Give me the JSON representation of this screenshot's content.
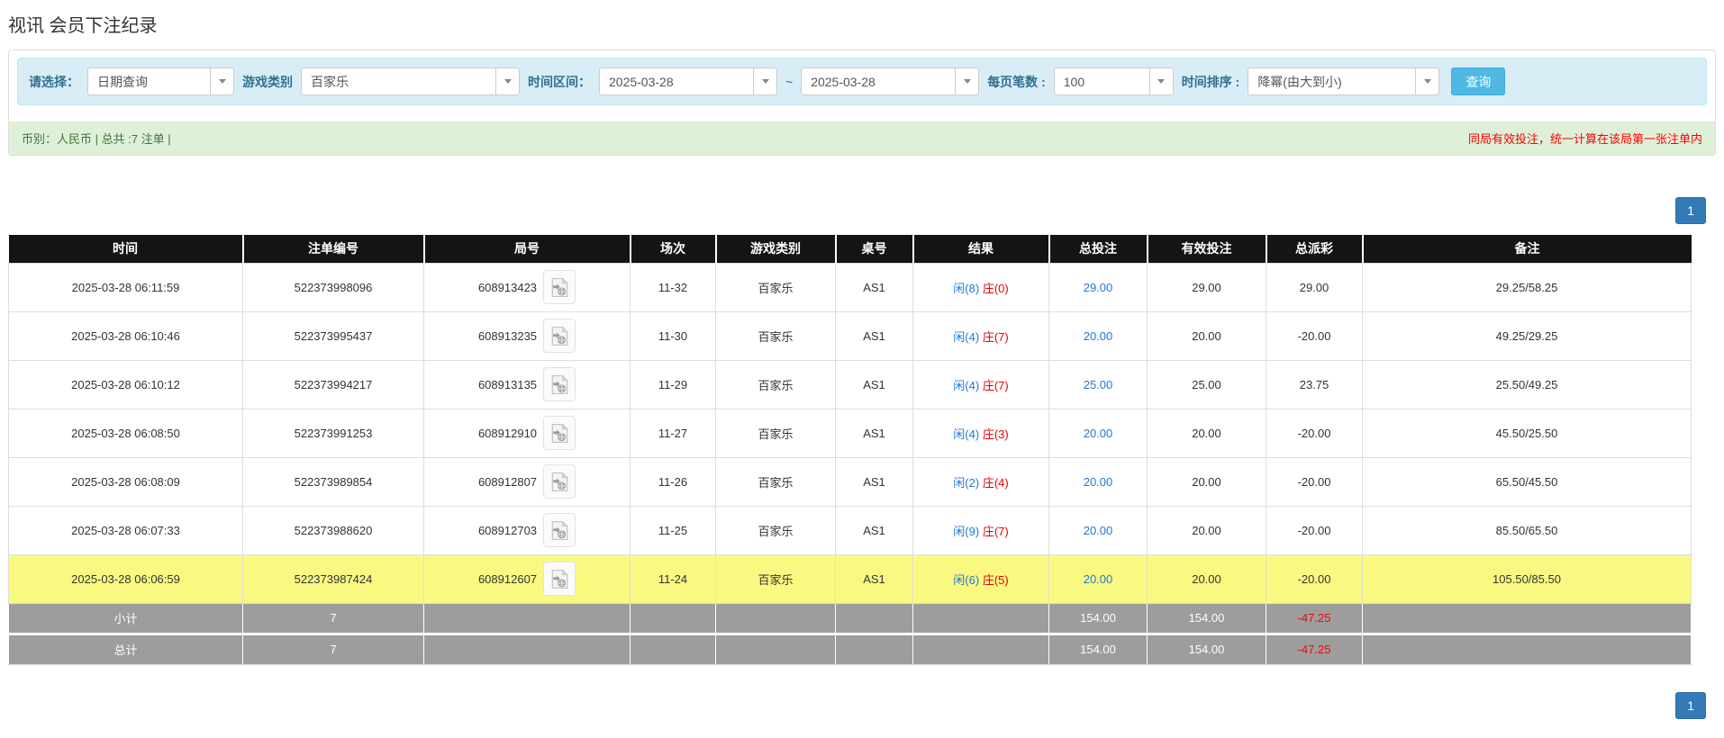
{
  "page": {
    "title": "视讯 会员下注纪录"
  },
  "filters": {
    "select_label": "请选择：",
    "select_value": "日期查询",
    "game_label": "游戏类别",
    "game_value": "百家乐",
    "range_label": "时间区间：",
    "date_from": "2025-03-28",
    "range_separator": "~",
    "date_to": "2025-03-28",
    "page_size_label": "每页笔数 :",
    "page_size_value": "100",
    "sort_label": "时间排序 :",
    "sort_value": "降幂(由大到小)",
    "search_button": "查询"
  },
  "summary": {
    "left_text": "币别：人民币 | 总共 :7 注单 |",
    "right_note": "同局有效投注，统一计算在该局第一张注单内"
  },
  "pagination": {
    "page": "1"
  },
  "table": {
    "headers": [
      "时间",
      "注单编号",
      "局号",
      "场次",
      "游戏类别",
      "桌号",
      "结果",
      "总投注",
      "有效投注",
      "总派彩",
      "备注"
    ],
    "rows": [
      {
        "time": "2025-03-28 06:11:59",
        "bet_id": "522373998096",
        "round_id": "608913423",
        "session": "11-32",
        "game": "百家乐",
        "table_no": "AS1",
        "result_player": "闲(8)",
        "result_banker": "庄(0)",
        "total_bet": "29.00",
        "valid_bet": "29.00",
        "payout": "29.00",
        "remark": "29.25/58.25",
        "highlight": false
      },
      {
        "time": "2025-03-28 06:10:46",
        "bet_id": "522373995437",
        "round_id": "608913235",
        "session": "11-30",
        "game": "百家乐",
        "table_no": "AS1",
        "result_player": "闲(4)",
        "result_banker": "庄(7)",
        "total_bet": "20.00",
        "valid_bet": "20.00",
        "payout": "-20.00",
        "remark": "49.25/29.25",
        "highlight": false
      },
      {
        "time": "2025-03-28 06:10:12",
        "bet_id": "522373994217",
        "round_id": "608913135",
        "session": "11-29",
        "game": "百家乐",
        "table_no": "AS1",
        "result_player": "闲(4)",
        "result_banker": "庄(7)",
        "total_bet": "25.00",
        "valid_bet": "25.00",
        "payout": "23.75",
        "remark": "25.50/49.25",
        "highlight": false
      },
      {
        "time": "2025-03-28 06:08:50",
        "bet_id": "522373991253",
        "round_id": "608912910",
        "session": "11-27",
        "game": "百家乐",
        "table_no": "AS1",
        "result_player": "闲(4)",
        "result_banker": "庄(3)",
        "total_bet": "20.00",
        "valid_bet": "20.00",
        "payout": "-20.00",
        "remark": "45.50/25.50",
        "highlight": false
      },
      {
        "time": "2025-03-28 06:08:09",
        "bet_id": "522373989854",
        "round_id": "608912807",
        "session": "11-26",
        "game": "百家乐",
        "table_no": "AS1",
        "result_player": "闲(2)",
        "result_banker": "庄(4)",
        "total_bet": "20.00",
        "valid_bet": "20.00",
        "payout": "-20.00",
        "remark": "65.50/45.50",
        "highlight": false
      },
      {
        "time": "2025-03-28 06:07:33",
        "bet_id": "522373988620",
        "round_id": "608912703",
        "session": "11-25",
        "game": "百家乐",
        "table_no": "AS1",
        "result_player": "闲(9)",
        "result_banker": "庄(7)",
        "total_bet": "20.00",
        "valid_bet": "20.00",
        "payout": "-20.00",
        "remark": "85.50/65.50",
        "highlight": false
      },
      {
        "time": "2025-03-28 06:06:59",
        "bet_id": "522373987424",
        "round_id": "608912607",
        "session": "11-24",
        "game": "百家乐",
        "table_no": "AS1",
        "result_player": "闲(6)",
        "result_banker": "庄(5)",
        "total_bet": "20.00",
        "valid_bet": "20.00",
        "payout": "-20.00",
        "remark": "105.50/85.50",
        "highlight": true
      }
    ],
    "subtotal": {
      "label": "小计",
      "count": "7",
      "total_bet": "154.00",
      "valid_bet": "154.00",
      "payout": "-47.25"
    },
    "grand_total": {
      "label": "总计",
      "count": "7",
      "total_bet": "154.00",
      "valid_bet": "154.00",
      "payout": "-47.25"
    }
  },
  "colors": {
    "link_blue": "#2279d2",
    "negative_red": "#ff0000",
    "banker_red": "#e60000",
    "highlight_yellow": "#f9f982",
    "summary_gray": "#9d9d9d",
    "header_black": "#141414",
    "search_button_blue": "#4fb9e3",
    "pager_blue": "#337ab7"
  }
}
